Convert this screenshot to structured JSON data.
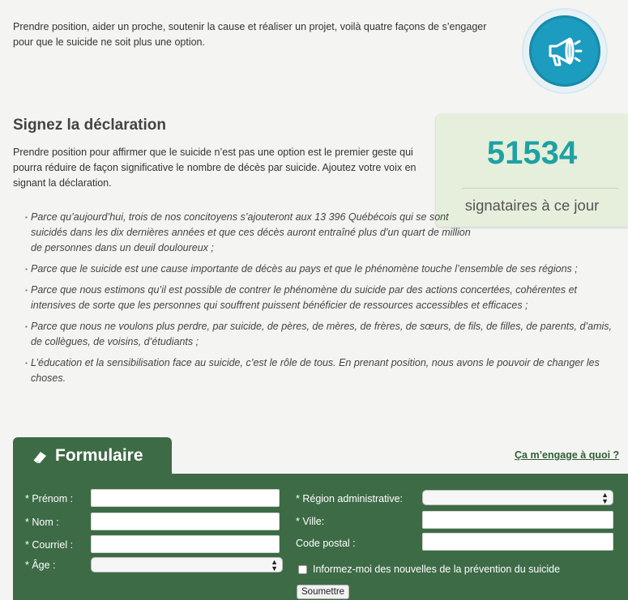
{
  "intro": {
    "text": "Prendre position, aider un proche, soutenir la cause et réaliser un projet, voilà quatre façons de s’engager pour que le suicide ne soit plus une option."
  },
  "badge_icon": "megaphone-icon",
  "declaration": {
    "title": "Signez la déclaration",
    "description": "Prendre position pour affirmer que le suicide n’est pas une option est le premier geste qui pourra réduire de façon significative le nombre de décès par suicide. Ajoutez votre voix en signant la déclaration.",
    "points": [
      "Parce qu’aujourd’hui, trois de nos concitoyens s’ajouteront aux 13 396 Québécois qui se sont suicidés dans les dix dernières années et que ces décès auront entraîné plus d’un quart de million de personnes dans un deuil douloureux ;",
      "Parce que le suicide est une cause importante de décès au pays et que le phénomène touche l’ensemble de ses régions ;",
      "Parce que nous estimons qu’il est possible de contrer le phénomène du suicide par des actions concertées, cohérentes et intensives de sorte que les personnes qui souffrent puissent bénéficier de ressources accessibles et efficaces ;",
      "Parce que nous ne voulons plus perdre, par suicide, de pères, de mères, de frères, de sœurs, de fils, de filles, de parents, d’amis, de collègues, de voisins, d’étudiants ;",
      "L’éducation et la sensibilisation face au suicide, c’est le rôle de tous. En prenant position, nous avons le pouvoir de changer les choses."
    ]
  },
  "counter": {
    "value": "51534",
    "label": "signataires à ce jour"
  },
  "form": {
    "tab_label": "Formulaire",
    "tab_icon": "eraser-icon",
    "engage_link": "Ça m’engage à quoi ?",
    "prenom_label": "* Prénom :",
    "nom_label": "* Nom :",
    "courriel_label": "* Courriel :",
    "age_label": "* Âge :",
    "region_label": "* Région administrative:",
    "ville_label": "* Ville:",
    "postal_label": "Code postal :",
    "newsletter_label": "Informez-moi des nouvelles de la prévention du suicide",
    "submit_label": "Soumettre",
    "prenom_value": "",
    "nom_value": "",
    "courriel_value": "",
    "ville_value": "",
    "postal_value": "",
    "age_selected": "",
    "region_selected": ""
  },
  "colors": {
    "form_green": "#3d6b46",
    "counter_teal": "#1ea1a3",
    "counter_bg": "#e5efdc",
    "badge_blue": "#1c9cbf"
  }
}
